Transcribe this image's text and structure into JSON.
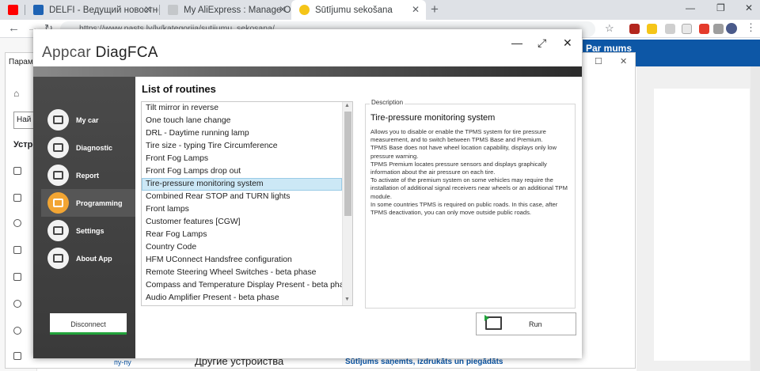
{
  "browser": {
    "tabs": [
      {
        "title": "",
        "favicon_color": "#ff0000",
        "favicon": "youtube-icon"
      },
      {
        "title": "DELFI - Ведущий новостной пор",
        "favicon_color": "#1e63b4",
        "favicon": "delfi-icon"
      },
      {
        "title": "My AliExpress : Manage Orders",
        "favicon_color": "#9aa0a6",
        "favicon": "page-icon"
      },
      {
        "title": "Sūtījumu sekošana",
        "favicon_color": "#f5c518",
        "favicon": "post-icon"
      }
    ],
    "address": "https://www.pasts.lv/lv/kategorija/sutijumu_sekosana/"
  },
  "background_page": {
    "nav_item": "Par mums",
    "window_title": "Парам",
    "search_placeholder": "Най",
    "heading": "Устро",
    "footer_left": "Другие устройства",
    "footer_small": "пу-пу",
    "footer_right": "Sūtījums saņemts, izdrukāts un piegādāts"
  },
  "app": {
    "title_part1": "Appcar ",
    "title_part2": "DiagFCA",
    "sidebar": [
      {
        "label": "My car",
        "icon": "car-icon"
      },
      {
        "label": "Diagnostic",
        "icon": "engine-icon"
      },
      {
        "label": "Report",
        "icon": "report-icon"
      },
      {
        "label": "Programming",
        "icon": "monitor-icon"
      },
      {
        "label": "Settings",
        "icon": "gear-icon"
      },
      {
        "label": "About App",
        "icon": "info-icon"
      }
    ],
    "active_index": 3,
    "disconnect_label": "Disconnect",
    "list_title": "List of routines",
    "routines": [
      "Tilt mirror in reverse",
      "One touch lane change",
      "DRL - Daytime running lamp",
      "Tire size - typing Tire Circumference",
      "Front Fog Lamps",
      "Front Fog Lamps drop out",
      "Tire-pressure monitoring system",
      "Combined Rear STOP and TURN lights",
      "Front lamps",
      "Customer features [CGW]",
      "Rear Fog Lamps",
      "Country Code",
      "HFM UConnect Handsfree configuration",
      "Remote Steering Wheel Switches - beta phase",
      "Compass and Temperature Display Present - beta phase",
      "Audio Amplifier Present - beta phase"
    ],
    "selected_index": 6,
    "description": {
      "legend": "Description",
      "title": "Tire-pressure monitoring system",
      "lines": [
        "Allows you to disable or enable the TPMS system for tire pressure measurement, and to switch between TPMS Base and Premium.",
        "TPMS Base does not have wheel location capability, displays only low pressure warning.",
        "TPMS Premium locates pressure sensors and displays graphically information about the air pressure on each tire.",
        "To activate of the premium system on some vehicles may require the installation of additional signal receivers near wheels or an additional TPM module.",
        "In some countries TPMS is required on public roads. In this case, after TPMS deactivation, you can only move outside public roads."
      ]
    },
    "run_label": "Run"
  }
}
